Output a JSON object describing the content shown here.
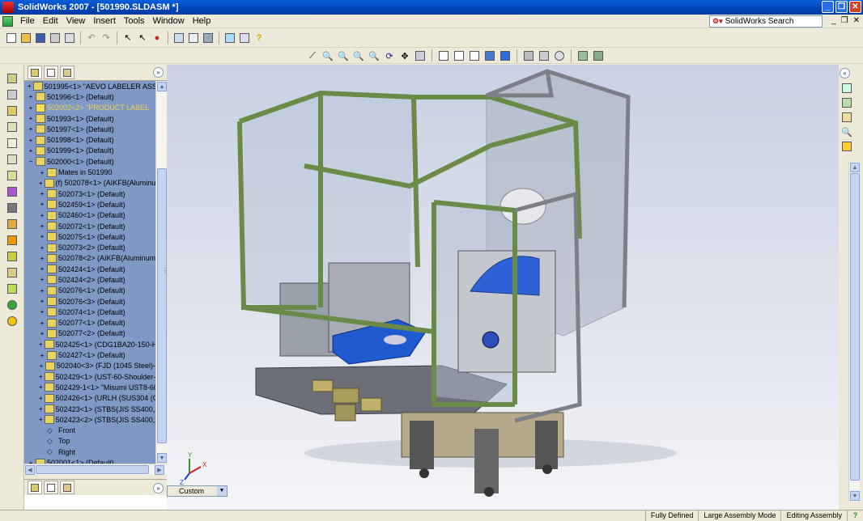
{
  "window": {
    "title": "SolidWorks 2007 - [501990.SLDASM *]",
    "app_icon": "solidworks-logo-icon"
  },
  "menubar": {
    "items": [
      "File",
      "Edit",
      "View",
      "Insert",
      "Tools",
      "Window",
      "Help"
    ],
    "search_label": "SolidWorks Search"
  },
  "feature_tree": {
    "items": [
      {
        "label": "501995<1> \"AEVO LABELER ASSE",
        "indent": 0,
        "pm": "+",
        "state": "normal"
      },
      {
        "label": "501996<1> (Default)",
        "indent": 0,
        "pm": "+",
        "state": "normal"
      },
      {
        "label": "502002<2> \"PRODUCT LABEL",
        "indent": 0,
        "pm": "+",
        "state": "warning"
      },
      {
        "label": "501993<1> (Default)",
        "indent": 0,
        "pm": "+",
        "state": "normal"
      },
      {
        "label": "501997<1> (Default)",
        "indent": 0,
        "pm": "+",
        "state": "normal"
      },
      {
        "label": "501998<1> (Default)",
        "indent": 0,
        "pm": "+",
        "state": "normal"
      },
      {
        "label": "501999<1> (Default)",
        "indent": 0,
        "pm": "+",
        "state": "normal"
      },
      {
        "label": "502000<1> (Default)",
        "indent": 0,
        "pm": "−",
        "state": "normal"
      },
      {
        "label": "Mates in 501990",
        "indent": 1,
        "pm": "+",
        "state": "normal"
      },
      {
        "label": "(f) 502078<1> (AIKFB(Aluminu",
        "indent": 1,
        "pm": "+",
        "state": "normal"
      },
      {
        "label": "502073<1> (Default)",
        "indent": 1,
        "pm": "+",
        "state": "normal"
      },
      {
        "label": "502459<1> (Default)",
        "indent": 1,
        "pm": "+",
        "state": "normal"
      },
      {
        "label": "502460<1> (Default)",
        "indent": 1,
        "pm": "+",
        "state": "normal"
      },
      {
        "label": "502072<1> (Default)",
        "indent": 1,
        "pm": "+",
        "state": "normal"
      },
      {
        "label": "502075<1> (Default)",
        "indent": 1,
        "pm": "+",
        "state": "normal"
      },
      {
        "label": "502073<2> (Default)",
        "indent": 1,
        "pm": "+",
        "state": "normal"
      },
      {
        "label": "502078<2> (AIKFB(Aluminum",
        "indent": 1,
        "pm": "+",
        "state": "normal"
      },
      {
        "label": "502424<1> (Default)",
        "indent": 1,
        "pm": "+",
        "state": "normal"
      },
      {
        "label": "502424<2> (Default)",
        "indent": 1,
        "pm": "+",
        "state": "normal"
      },
      {
        "label": "502076<1> (Default)",
        "indent": 1,
        "pm": "+",
        "state": "normal"
      },
      {
        "label": "502076<3> (Default)",
        "indent": 1,
        "pm": "+",
        "state": "normal"
      },
      {
        "label": "502074<1> (Default)",
        "indent": 1,
        "pm": "+",
        "state": "normal"
      },
      {
        "label": "502077<1> (Default)",
        "indent": 1,
        "pm": "+",
        "state": "normal"
      },
      {
        "label": "502077<2> (Default)",
        "indent": 1,
        "pm": "+",
        "state": "normal"
      },
      {
        "label": "502425<1> (CDG1BA20-150-H",
        "indent": 1,
        "pm": "+",
        "state": "normal"
      },
      {
        "label": "502427<1> (Default)",
        "indent": 1,
        "pm": "+",
        "state": "normal"
      },
      {
        "label": "502040<3> (FJD (1045 Steel)-",
        "indent": 1,
        "pm": "+",
        "state": "normal"
      },
      {
        "label": "502429<1> (UST-60-Shoulder-",
        "indent": 1,
        "pm": "+",
        "state": "normal"
      },
      {
        "label": "502429-1<1> \"Misumi UST8-60",
        "indent": 1,
        "pm": "+",
        "state": "normal"
      },
      {
        "label": "502426<1> (URLH (SUS304 (C",
        "indent": 1,
        "pm": "+",
        "state": "normal"
      },
      {
        "label": "502423<1> (STBS(JIS SS400,2",
        "indent": 1,
        "pm": "+",
        "state": "normal"
      },
      {
        "label": "502423<2> (STBS(JIS SS400,2",
        "indent": 1,
        "pm": "+",
        "state": "normal"
      },
      {
        "label": "Front",
        "indent": 1,
        "pm": "",
        "state": "plane"
      },
      {
        "label": "Top",
        "indent": 1,
        "pm": "",
        "state": "plane"
      },
      {
        "label": "Right",
        "indent": 1,
        "pm": "",
        "state": "plane"
      },
      {
        "label": "502001<1> (Default)",
        "indent": 0,
        "pm": "+",
        "state": "normal"
      }
    ]
  },
  "graphics": {
    "configuration": "Custom",
    "triad_labels": [
      "Y",
      "X",
      "Z"
    ]
  },
  "statusbar": {
    "cells": [
      "Fully Defined",
      "Large Assembly Mode",
      "Editing Assembly"
    ],
    "help": "?"
  },
  "colors": {
    "frame_green": "#6b8a47",
    "tree_bg": "#7f98c6",
    "turntable_blue": "#1e5ad0",
    "title_blue": "#0a5fd8"
  }
}
